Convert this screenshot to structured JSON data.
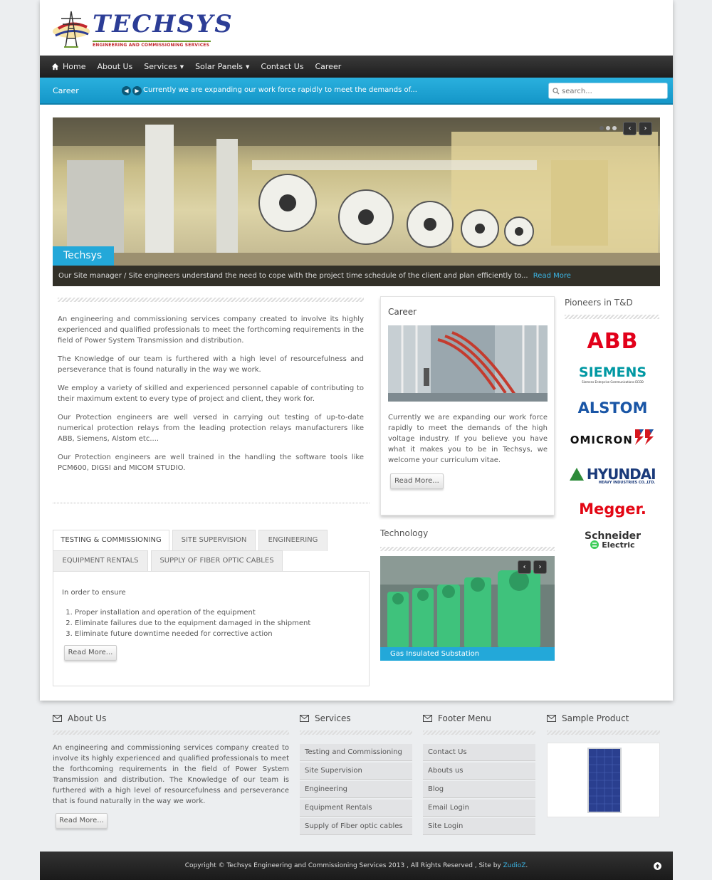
{
  "brand": {
    "name": "TECHSYS",
    "tagline": "ENGINEERING AND COMMISSIONING SERVICES"
  },
  "nav": {
    "home": "Home",
    "about": "About Us",
    "services": "Services",
    "solar": "Solar Panels",
    "contact": "Contact Us",
    "career": "Career"
  },
  "ticker": {
    "label": "Career",
    "text": "Currently we are expanding our work force rapidly to meet the demands of..."
  },
  "search": {
    "placeholder": "search..."
  },
  "slider": {
    "title": "Techsys",
    "caption": "Our Site manager / Site engineers understand the need to cope with the project time schedule of the client and plan efficiently to...",
    "read_more": "Read More"
  },
  "intro": {
    "p1": "An engineering and commissioning services company created to involve its highly experienced and qualified professionals to meet the forthcoming requirements in the field of Power System Transmission and distribution.",
    "p2": "The Knowledge of our team is furthered with a high level of resourcefulness and perseverance that is found naturally in the way we work.",
    "p3": "We employ a variety of skilled and experienced personnel capable of contributing to their maximum extent to every type of project and client, they work for.",
    "p4": "Our Protection engineers are well versed in carrying out testing of up-to-date numerical protection relays from the leading protection relays manufacturers like ABB, Siemens, Alstom etc....",
    "p5": "Our Protection engineers are well trained in the handling the software tools like PCM600, DIGSI and MICOM STUDIO."
  },
  "tabs": {
    "t1": "TESTING & COMMISSIONING",
    "t2": "SITE SUPERVISION",
    "t3": "ENGINEERING",
    "t4": "EQUIPMENT RENTALS",
    "t5": "SUPPLY OF FIBER OPTIC CABLES",
    "lead": "In order to ensure",
    "items": [
      "Proper installation and operation of the equipment",
      "Eliminate failures due to the equipment damaged in the shipment",
      "Eliminate future downtime needed for corrective action"
    ],
    "read_more": "Read More..."
  },
  "career": {
    "title": "Career",
    "text": "Currently we are expanding our work force rapidly to meet the demands of the high voltage industry. If you believe you have what it makes you to be in Techsys, we welcome your curriculum vitae.",
    "read_more": "Read More..."
  },
  "technology": {
    "title": "Technology",
    "caption": "Gas Insulated Substation"
  },
  "pioneers": {
    "title": "Pioneers in T&D",
    "abb": "ABB",
    "siemens": "SIEMENS",
    "siemens_sub": "Siemens Enterprise Communications ECOD",
    "alstom": "ALSTOM",
    "omicron": "OMICRON",
    "hyundai": "HYUNDAI",
    "hyundai_sub": "HEAVY INDUSTRIES CO.,LTD.",
    "megger": "Megger.",
    "schneider": "Schneider",
    "schneider_sub": "Electric"
  },
  "footer": {
    "about_title": "About Us",
    "about_text": "An engineering and commissioning services company created to involve its highly experienced and qualified professionals to meet the forthcoming requirements in the field of Power System Transmission and distribution. The Knowledge of our team is furthered with a high level of resourcefulness and perseverance that is found naturally in the way we work.",
    "about_read_more": "Read More...",
    "services_title": "Services",
    "services": [
      "Testing and Commissioning",
      "Site Supervision",
      "Engineering",
      "Equipment Rentals",
      "Supply of Fiber optic cables"
    ],
    "menu_title": "Footer Menu",
    "menu": [
      "Contact Us",
      "Abouts us",
      "Blog",
      "Email Login",
      "Site Login"
    ],
    "product_title": "Sample Product"
  },
  "copyright": {
    "text": "Copyright © Techsys Engineering and Commissioning Services 2013 , All Rights Reserved , Site by ",
    "link": "ZudioZ",
    "end": "."
  },
  "colors": {
    "accent": "#23a8d9",
    "nav_bg": "#2a2a2a",
    "logo_blue": "#2c3d96",
    "logo_red": "#c1272d"
  }
}
